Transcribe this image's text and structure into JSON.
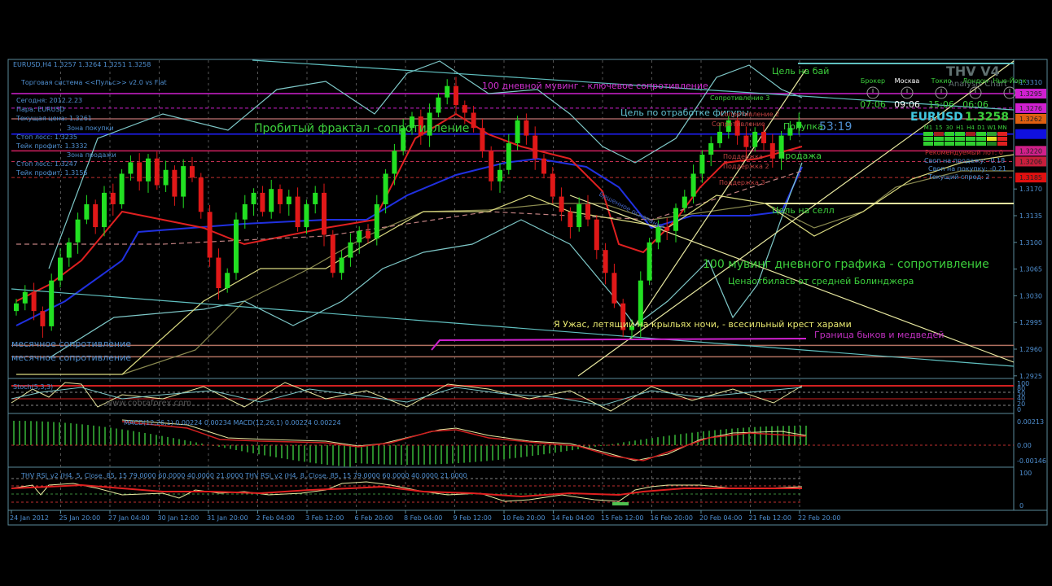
{
  "header": {
    "symbol_line": "EURUSD,H4  1.3257 1.3264 1.3251 1.3258",
    "system_title": "Торговая система <<Пульс>> v2.0 vs Flat"
  },
  "info_panel": {
    "today": "Сегодня:  2012.2.23",
    "pair": "Пара:  EURUSD",
    "current_price": "Текущая цена: 1.3261",
    "buy_zone": "Зона покупки",
    "buy_stop": "Стоп лосс:        1.3235",
    "buy_take": "Тейк профит:    1.3332",
    "sell_zone": "Зона продажи",
    "sell_stop": "Стоп лосс:        1.3247",
    "sell_take": "Тейк профит:    1.3156"
  },
  "clocks": [
    {
      "city": "Брокер",
      "time": "07:06",
      "color": "#3ccf3c"
    },
    {
      "city": "Москва",
      "time": "09:06",
      "color": "#ffffff"
    },
    {
      "city": "Токио",
      "time": "15:06",
      "color": "#3ccf3c"
    },
    {
      "city": "Лондон",
      "time": "06:06",
      "color": "#3ccf3c"
    },
    {
      "city": "Нью-Йорк",
      "time": "",
      "color": "#3ccf3c"
    }
  ],
  "right_panel": {
    "logo": "THV V4",
    "logo_sub": "Analysis Chart",
    "symbol": "EURUSD",
    "price": "1.3258",
    "timeframes": [
      "M1",
      "15",
      "30",
      "H1",
      "H4",
      "D1",
      "W1",
      "MN"
    ],
    "recommended_lot": "Рекомендуемый лот: 0",
    "swap_sell": "Своп на продажу: -0.18",
    "swap_buy": "Своп на покупку: -0.21",
    "spread": "Текущий спред: 2",
    "countdown": "53:19"
  },
  "annotations": {
    "ma100_daily": "100 дневной мувинг - ключевое сопротивление",
    "buy_target": "Цель на бай",
    "fractal_target": "Цель по отработке фигуры",
    "resistance3": "Сопротивление 3",
    "resistance2": "Сопротивление 2",
    "resistance1": "Сопротивление",
    "support1": "Поддержка",
    "support2": "Поддержка 2",
    "support3": "Поддержка 3",
    "buy": "Покупка",
    "sell": "Продажа",
    "broken_fractal": "Пробитый фрактал -сопротивление",
    "base": "Бешенное основание",
    "sell_target": "Цель на селл",
    "ma100_chart": "100 мувинг дневного графика - сопротивление",
    "bollinger": "Ценаотбилась от средней Болинджера",
    "harami": "Я Ужас, летящий на крыльях ночи, - всесильный крест харами",
    "bull_bear": "Граница быков и медведей",
    "monthly1": "месячное сопротивление",
    "monthly2": "месячное сопротивление",
    "watermark": "www.cobraforex.com"
  },
  "indicators": {
    "stoch_label": "Stoch(5,3,3)",
    "macd_label": "MACD(12,26,1) 0.00224 0.00234   MACD(12,26,1) 0.00224 0.00224",
    "rsi_label": "THV RSI_v2  (H4, 5, Close, 85, 15 79.0000 60.0000 40.0000 21.0000     THV RSI_v2  (H4, 8, Close, 85, 15 79.0000 60.0000 40.0000 21.0000",
    "stoch_ticks": [
      "100",
      "80",
      "50",
      "40",
      "20",
      "0"
    ],
    "macd_ticks": [
      "0.00213",
      "0.00",
      "-0.00146"
    ],
    "rsi_ticks": [
      "100",
      "0"
    ]
  },
  "chart_data": {
    "type": "candlestick",
    "symbol": "EURUSD",
    "timeframe": "H4",
    "ylim": [
      1.2905,
      1.333
    ],
    "price_ticks": [
      "1.3310",
      "1.3170",
      "1.3135",
      "1.3100",
      "1.3065",
      "1.3030",
      "1.2995",
      "1.2960",
      "1.2925"
    ],
    "price_tags": [
      {
        "value": "1.3295",
        "color": "#d020d0"
      },
      {
        "value": "1.3276",
        "color": "#d020d0"
      },
      {
        "value": "1.3262",
        "color": "#e06010"
      },
      {
        "value": "",
        "color": "#1010e0",
        "price": 1.3242
      },
      {
        "value": "1.3220",
        "color": "#d0208a"
      },
      {
        "value": "1.3206",
        "color": "#c81e3c"
      },
      {
        "value": "1.3185",
        "color": "#e01010"
      }
    ],
    "date_labels": [
      "24 Jan 2012",
      "25 Jan 20:00",
      "27 Jan 04:00",
      "30 Jan 12:00",
      "31 Jan 20:00",
      "2 Feb 04:00",
      "3 Feb 12:00",
      "6 Feb 20:00",
      "8 Feb 04:00",
      "9 Feb 12:00",
      "10 Feb 20:00",
      "14 Feb 04:00",
      "15 Feb 12:00",
      "16 Feb 20:00",
      "20 Feb 04:00",
      "21 Feb 12:00",
      "22 Feb 20:00"
    ],
    "closes": [
      1.302,
      1.3035,
      1.301,
      1.299,
      1.305,
      1.308,
      1.31,
      1.313,
      1.315,
      1.312,
      1.3165,
      1.315,
      1.319,
      1.3205,
      1.318,
      1.321,
      1.3175,
      1.3195,
      1.316,
      1.32,
      1.3185,
      1.314,
      1.308,
      1.304,
      1.306,
      1.313,
      1.315,
      1.3165,
      1.314,
      1.317,
      1.315,
      1.316,
      1.312,
      1.315,
      1.3165,
      1.311,
      1.306,
      1.308,
      1.31,
      1.3115,
      1.3105,
      1.315,
      1.319,
      1.322,
      1.325,
      1.3265,
      1.324,
      1.327,
      1.329,
      1.3305,
      1.328,
      1.327,
      1.325,
      1.322,
      1.318,
      1.3195,
      1.323,
      1.326,
      1.324,
      1.321,
      1.319,
      1.316,
      1.314,
      1.312,
      1.315,
      1.313,
      1.309,
      1.306,
      1.302,
      1.2985,
      1.299,
      1.305,
      1.31,
      1.312,
      1.3115,
      1.3145,
      1.316,
      1.319,
      1.3215,
      1.323,
      1.3245,
      1.326,
      1.324,
      1.3225,
      1.3245,
      1.323,
      1.321,
      1.324,
      1.325,
      1.3258
    ],
    "levels": [
      {
        "price": 1.3295,
        "color": "#d020d0",
        "style": "solid"
      },
      {
        "price": 1.3276,
        "color": "#d020d0",
        "style": "dash"
      },
      {
        "price": 1.3262,
        "color": "#a06060",
        "style": "solid"
      },
      {
        "price": 1.3242,
        "color": "#2020ff",
        "style": "solid"
      },
      {
        "price": 1.322,
        "color": "#d02060",
        "style": "solid"
      },
      {
        "price": 1.3206,
        "color": "#c03050",
        "style": "dash"
      },
      {
        "price": 1.3185,
        "color": "#c03030",
        "style": "dash"
      },
      {
        "price": 1.2965,
        "color": "#b07060",
        "style": "solid"
      },
      {
        "price": 1.295,
        "color": "#b07060",
        "style": "solid"
      }
    ],
    "colors": {
      "bull": "#22e022",
      "bear": "#e01818",
      "axis": "#4f8fd0",
      "frame": "#5a8a9a"
    }
  }
}
